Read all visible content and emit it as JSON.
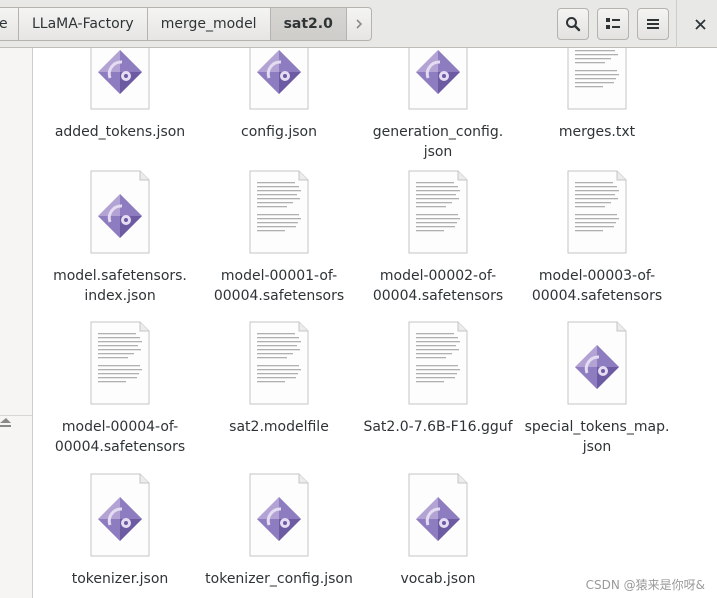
{
  "breadcrumbs": {
    "first": "e",
    "items": [
      "LLaMA-Factory",
      "merge_model"
    ],
    "current": "sat2.0"
  },
  "toolbar": {
    "search_icon": "search-icon",
    "view_icon": "grid-view-icon",
    "menu_icon": "hamburger-menu-icon",
    "close_icon": "close-icon"
  },
  "files": [
    {
      "name": "added_tokens.json",
      "icon": "json"
    },
    {
      "name": "config.json",
      "icon": "json"
    },
    {
      "name": "generation_config.\njson",
      "icon": "json"
    },
    {
      "name": "merges.txt",
      "icon": "text"
    },
    {
      "name": "model.safetensors.\nindex.json",
      "icon": "json"
    },
    {
      "name": "model-00001-of-\n00004.safetensors",
      "icon": "text"
    },
    {
      "name": "model-00002-of-\n00004.safetensors",
      "icon": "text"
    },
    {
      "name": "model-00003-of-\n00004.safetensors",
      "icon": "text"
    },
    {
      "name": "model-00004-of-\n00004.safetensors",
      "icon": "text"
    },
    {
      "name": "sat2.modelfile",
      "icon": "text"
    },
    {
      "name": "Sat2.0-7.6B-F16.gguf",
      "icon": "text"
    },
    {
      "name": "special_tokens_map.\njson",
      "icon": "json"
    },
    {
      "name": "tokenizer.json",
      "icon": "json"
    },
    {
      "name": "tokenizer_config.json",
      "icon": "json"
    },
    {
      "name": "vocab.json",
      "icon": "json"
    }
  ],
  "watermark": "CSDN @猿来是你呀&",
  "colors": {
    "json_icon_light": "#b6a6d6",
    "json_icon_dark": "#6f5ca6",
    "header_bg": "#e8e8e7"
  }
}
